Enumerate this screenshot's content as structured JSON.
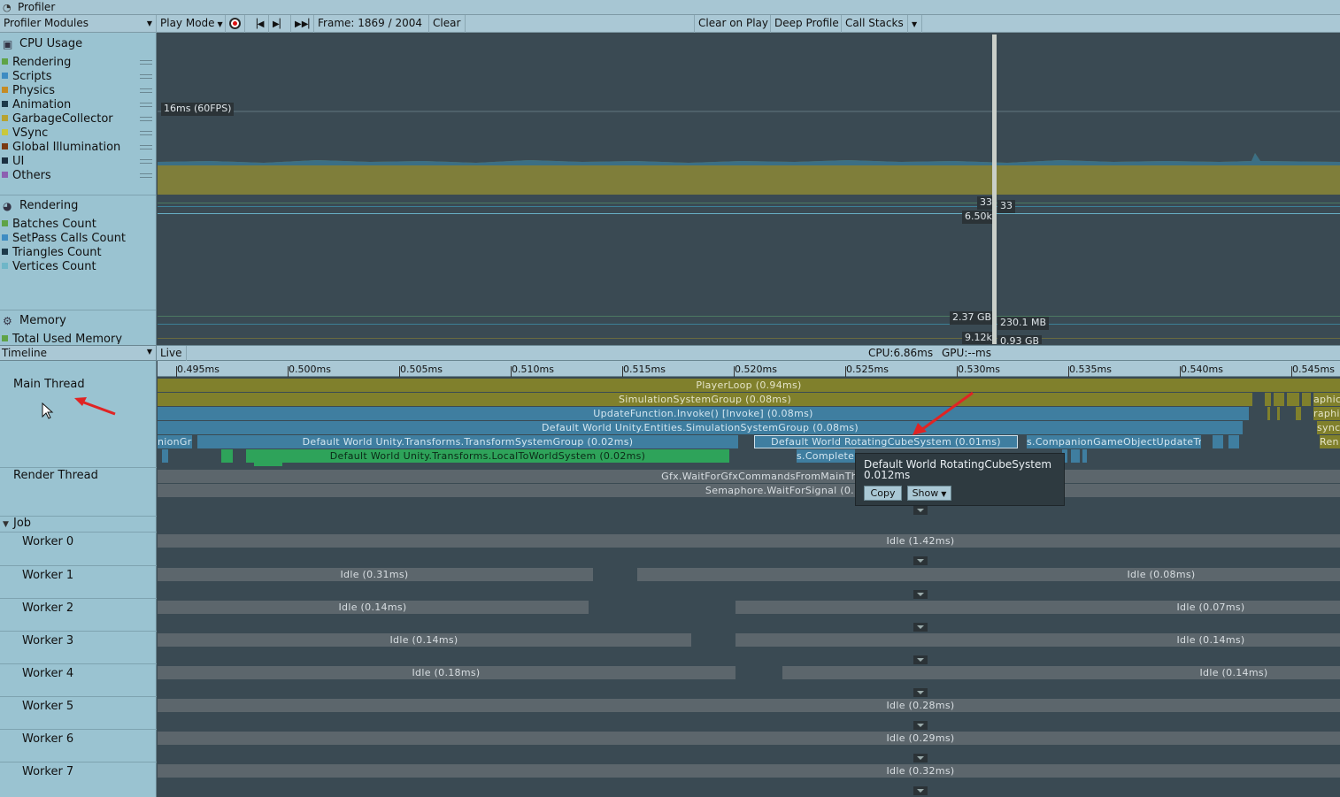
{
  "window": {
    "title": "Profiler"
  },
  "toolbar": {
    "modules_label": "Profiler Modules",
    "play_mode_label": "Play Mode",
    "frame_label": "Frame: 1869 / 2004",
    "clear_label": "Clear",
    "clear_on_play_label": "Clear on Play",
    "deep_profile_label": "Deep Profile",
    "call_stacks_label": "Call Stacks"
  },
  "modules": {
    "cpu": {
      "title": "CPU Usage",
      "items": [
        {
          "label": "Rendering",
          "color": "#5fa347"
        },
        {
          "label": "Scripts",
          "color": "#3e8cc2"
        },
        {
          "label": "Physics",
          "color": "#c58b24"
        },
        {
          "label": "Animation",
          "color": "#1e3a4a"
        },
        {
          "label": "GarbageCollector",
          "color": "#b7a231"
        },
        {
          "label": "VSync",
          "color": "#c9c83c"
        },
        {
          "label": "Global Illumination",
          "color": "#7a3a12"
        },
        {
          "label": "UI",
          "color": "#1b2f40"
        },
        {
          "label": "Others",
          "color": "#8d5fb1"
        }
      ],
      "target_label": "16ms (60FPS)"
    },
    "rendering": {
      "title": "Rendering",
      "items": [
        {
          "label": "Batches Count",
          "color": "#5fa347"
        },
        {
          "label": "SetPass Calls Count",
          "color": "#3e8cc2"
        },
        {
          "label": "Triangles Count",
          "color": "#1e3a4a"
        },
        {
          "label": "Vertices Count",
          "color": "#6fb6c8"
        }
      ],
      "value_a": "33",
      "value_b": "33",
      "value_c": "6.50k"
    },
    "memory": {
      "title": "Memory",
      "items": [
        {
          "label": "Total Used Memory",
          "color": "#5fa347"
        }
      ],
      "value_a": "2.37 GB",
      "value_b": "230.1 MB",
      "value_c": "9.12k",
      "value_d": "0.93 GB"
    }
  },
  "timeline": {
    "view_label": "Timeline",
    "live_label": "Live",
    "cpu_label": "CPU:6.86ms",
    "gpu_label": "GPU:--ms",
    "ticks": [
      "0.495ms",
      "0.500ms",
      "0.505ms",
      "0.510ms",
      "0.515ms",
      "0.520ms",
      "0.525ms",
      "0.530ms",
      "0.535ms",
      "0.540ms",
      "0.545ms"
    ],
    "main_thread_label": "Main Thread",
    "render_thread_label": "Render Thread",
    "job_label": "Job",
    "main_bars": {
      "player_loop": "PlayerLoop (0.94ms)",
      "simulation": "SimulationSystemGroup (0.08ms)",
      "update_function": "UpdateFunction.Invoke() [Invoke] (0.08ms)",
      "entities_sim": "Default World Unity.Entities.SimulationSystemGroup (0.08ms)",
      "transform_system": "Default World Unity.Transforms.TransformSystemGroup (0.02ms)",
      "rotating_cube": "Default World RotatingCubeSystem (0.01ms)",
      "companion": "s.CompanionGameObjectUpdateTr",
      "union": "nionGr",
      "local_to_world": "Default World Unity.Transforms.LocalToWorldSystem (0.02ms)",
      "complete": "s.Complete",
      "right_graphic": "aphic",
      "right_graphi2": "raphi",
      "right_sync": "sync",
      "right_ren": "Ren"
    },
    "render_bars": {
      "gfx_wait": "Gfx.WaitForGfxCommandsFromMainTh",
      "semaphore": "Semaphore.WaitForSignal (0.:"
    },
    "workers": [
      {
        "label": "Worker 0",
        "bars": [
          "Idle (1.42ms)"
        ]
      },
      {
        "label": "Worker 1",
        "bars": [
          "Idle (0.31ms)",
          "Idle (0.08ms)"
        ]
      },
      {
        "label": "Worker 2",
        "bars": [
          "Idle (0.14ms)",
          "Idle (0.07ms)"
        ]
      },
      {
        "label": "Worker 3",
        "bars": [
          "Idle (0.14ms)",
          "Idle (0.14ms)"
        ]
      },
      {
        "label": "Worker 4",
        "bars": [
          "Idle (0.18ms)",
          "Idle (0.14ms)"
        ]
      },
      {
        "label": "Worker 5",
        "bars": [
          "Idle (0.28ms)"
        ]
      },
      {
        "label": "Worker 6",
        "bars": [
          "Idle (0.29ms)"
        ]
      },
      {
        "label": "Worker 7",
        "bars": [
          "Idle (0.32ms)"
        ]
      }
    ]
  },
  "tooltip": {
    "name": "Default World RotatingCubeSystem",
    "value": "0.012ms",
    "copy_label": "Copy",
    "show_label": "Show"
  },
  "colors": {
    "sidebar": "#9ac3d1",
    "toolbar": "#aac8d5",
    "chart_bg": "#3a4a53",
    "olive": "#80802c",
    "blue": "#3f7ea0",
    "green": "#2ea35a",
    "annotation_arrow": "#e02424"
  }
}
